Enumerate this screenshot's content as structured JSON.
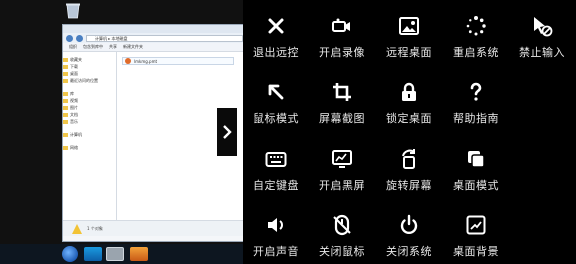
{
  "desktop": {
    "explorer": {
      "address": "计算机 ▸ 本地磁盘",
      "toolbar": [
        "组织",
        "包含到库中",
        "共享",
        "新建文件夹"
      ],
      "sidebar": [
        "收藏夹",
        "下载",
        "桌面",
        "最近访问的位置",
        "库",
        "视频",
        "图片",
        "文档",
        "音乐",
        "计算机",
        "网络"
      ],
      "file": "lmkmg.pmt",
      "status": "1 个对象"
    }
  },
  "menu": {
    "items": [
      {
        "label": "退出远控",
        "icon": "close-icon"
      },
      {
        "label": "开启录像",
        "icon": "video-icon"
      },
      {
        "label": "远程桌面",
        "icon": "image-icon"
      },
      {
        "label": "重启系统",
        "icon": "spinner-icon"
      },
      {
        "label": "禁止输入",
        "icon": "cursor-block-icon"
      },
      {
        "label": "鼠标模式",
        "icon": "arrow-up-left-icon"
      },
      {
        "label": "屏幕截图",
        "icon": "crop-icon"
      },
      {
        "label": "锁定桌面",
        "icon": "lock-icon"
      },
      {
        "label": "帮助指南",
        "icon": "question-icon"
      },
      {
        "label": "自定键盘",
        "icon": "keyboard-icon"
      },
      {
        "label": "开启黑屏",
        "icon": "monitor-icon"
      },
      {
        "label": "旋转屏幕",
        "icon": "rotate-icon"
      },
      {
        "label": "桌面模式",
        "icon": "desktop-mode-icon"
      },
      {
        "label": "开启声音",
        "icon": "speaker-icon"
      },
      {
        "label": "关闭鼠标",
        "icon": "mouse-off-icon"
      },
      {
        "label": "关闭系统",
        "icon": "power-icon"
      },
      {
        "label": "桌面背景",
        "icon": "wallpaper-icon"
      }
    ]
  }
}
